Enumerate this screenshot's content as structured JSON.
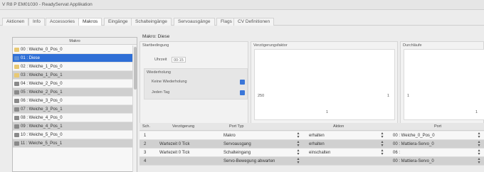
{
  "window": {
    "title": "V R8 P EM01030 - ReadyServat Applikation"
  },
  "tabs": [
    {
      "label": "Aktionen"
    },
    {
      "label": "Info"
    },
    {
      "label": "Accessories"
    },
    {
      "label": "Makros"
    },
    {
      "label": "Eingänge"
    },
    {
      "label": "Schalteingänge"
    },
    {
      "label": "Servoausgänge"
    },
    {
      "label": "Flags"
    },
    {
      "label": "CV Definitionen"
    }
  ],
  "left": {
    "header": "Makro",
    "items": [
      {
        "label": "00 : Weiche_0_Pos_0",
        "icon": "folder-icon"
      },
      {
        "label": "01 : Diese",
        "icon": "doc-icon"
      },
      {
        "label": "02 : Weiche_1_Pos_0",
        "icon": "folder-icon"
      },
      {
        "label": "03 : Weiche_1_Pos_1",
        "icon": "folder-icon"
      },
      {
        "label": "04 : Weiche_2_Pos_0",
        "icon": "doc-icon"
      },
      {
        "label": "05 : Weiche_2_Pos_1",
        "icon": "doc-icon"
      },
      {
        "label": "06 : Weiche_3_Pos_0",
        "icon": "doc-icon"
      },
      {
        "label": "07 : Weiche_3_Pos_1",
        "icon": "doc-icon"
      },
      {
        "label": "08 : Weiche_4_Pos_0",
        "icon": "doc-icon"
      },
      {
        "label": "09 : Weiche_4_Pos_1",
        "icon": "doc-icon"
      },
      {
        "label": "10 : Weiche_5_Pos_0",
        "icon": "doc-icon"
      },
      {
        "label": "11 : Weiche_5_Pos_1",
        "icon": "doc-icon"
      }
    ]
  },
  "main": {
    "title": "Makro: Diese",
    "groups": {
      "start": {
        "header": "Startbedingung",
        "uhrzeit_label": "Uhrzeit",
        "uhrzeit_value": "00:15",
        "wiederholung_header": "Wiederholung",
        "wiederholung_items": [
          "Keine Wiederholung",
          "Jeden Tag"
        ]
      },
      "delay": {
        "header": "Verzögerungsfaktor",
        "value": "250",
        "number": "1",
        "scale": "1"
      },
      "passes": {
        "header": "Durchläufe",
        "value": "1",
        "scale": "1"
      }
    },
    "table": {
      "headers": [
        "Sch.",
        "Verzögerung",
        "Port Typ",
        "Aktion",
        "Port"
      ],
      "rows": [
        {
          "sch": "1",
          "delay": "",
          "porttyp": "Makro",
          "aktion": "erhalten",
          "port": "00 : Weiche_0_Pos_0"
        },
        {
          "sch": "2",
          "delay": "Wartezeit 0 Tick",
          "porttyp": "Servoausgang",
          "aktion": "erhalten",
          "port": "00 : Mattiera-Servo_0"
        },
        {
          "sch": "3",
          "delay": "Wartezeit 0 Tick",
          "porttyp": "Schalteingang",
          "aktion": "einschalten",
          "port": "06 :"
        },
        {
          "sch": "4",
          "delay": "",
          "porttyp": "Servo-Bewegung abwarten",
          "aktion": "",
          "port": "00 : Mattiera-Servo_0"
        }
      ]
    }
  },
  "colors": {
    "selection": "#2f6fd6",
    "accent_button": "#3a76d8"
  }
}
